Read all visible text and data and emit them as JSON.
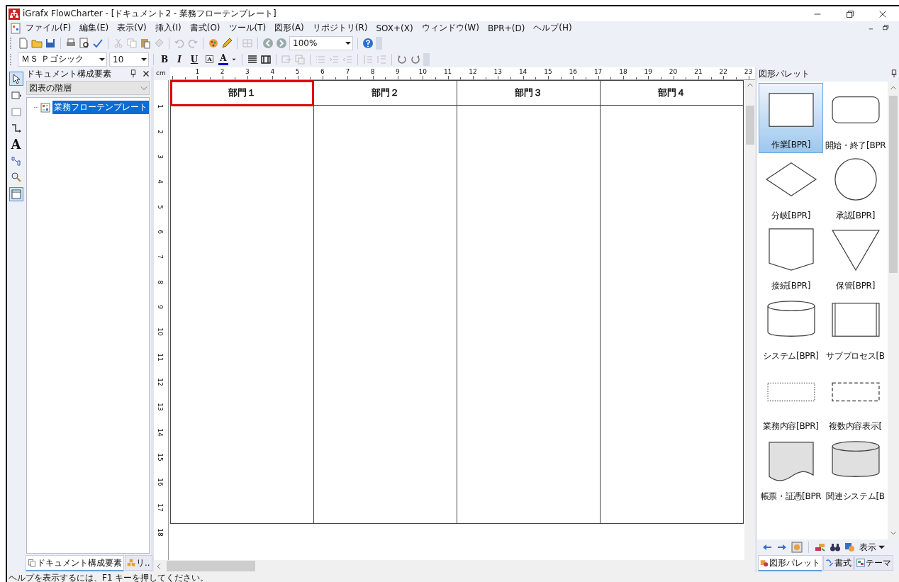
{
  "window": {
    "title": "iGrafx FlowCharter - [ドキュメント2 - 業務フローテンプレート]"
  },
  "menu": [
    "ファイル(F)",
    "編集(E)",
    "表示(V)",
    "挿入(I)",
    "書式(O)",
    "ツール(T)",
    "図形(A)",
    "リポジトリ(R)",
    "SOX+(X)",
    "ウィンドウ(W)",
    "BPR+(D)",
    "ヘルプ(H)"
  ],
  "toolbar": {
    "zoom": "100%"
  },
  "format_bar": {
    "font": "ＭＳ Ｐゴシック",
    "size": "10",
    "bold": "B",
    "italic": "I",
    "underline": "U",
    "small_a": "A",
    "font_color": "A"
  },
  "tool_strip": {
    "text_tool": "A"
  },
  "document_panel": {
    "title": "ドキュメント構成要素",
    "view": "図表の階層",
    "tree": [
      {
        "label": "業務フローテンプレート",
        "selected": true
      }
    ],
    "tabs": [
      {
        "label": "ドキュメント構成要素",
        "selected": true
      },
      {
        "label": "リ..",
        "selected": false
      }
    ]
  },
  "ruler": {
    "unit": "cm",
    "x_labels": [
      "1",
      "2",
      "3",
      "4",
      "5",
      "6",
      "7",
      "8",
      "9",
      "10",
      "11",
      "12",
      "13",
      "14",
      "15",
      "16",
      "17",
      "18",
      "19",
      "20",
      "21",
      "22",
      "23"
    ],
    "y_labels": [
      "1",
      "2",
      "3",
      "4",
      "5",
      "6",
      "7",
      "8",
      "9",
      "10",
      "11",
      "12",
      "13",
      "14",
      "15",
      "16",
      "17",
      "18"
    ]
  },
  "lanes": [
    {
      "label": "部門１",
      "highlighted": true
    },
    {
      "label": "部門２",
      "highlighted": false
    },
    {
      "label": "部門３",
      "highlighted": false
    },
    {
      "label": "部門４",
      "highlighted": false
    }
  ],
  "palette": {
    "title": "図形パレット",
    "shapes": [
      {
        "label": "作業[BPR]",
        "kind": "rect",
        "selected": true,
        "shaded": false
      },
      {
        "label": "開始・終了[BPR",
        "kind": "rounded",
        "selected": false,
        "shaded": false
      },
      {
        "label": "分岐[BPR]",
        "kind": "diamond",
        "selected": false,
        "shaded": false
      },
      {
        "label": "承認[BPR]",
        "kind": "circle",
        "selected": false,
        "shaded": false
      },
      {
        "label": "接続[BPR]",
        "kind": "offpage",
        "selected": false,
        "shaded": false
      },
      {
        "label": "保管[BPR]",
        "kind": "triangle",
        "selected": false,
        "shaded": false
      },
      {
        "label": "システム[BPR]",
        "kind": "cylinder",
        "selected": false,
        "shaded": false
      },
      {
        "label": "サブプロセス[B",
        "kind": "subprocess",
        "selected": false,
        "shaded": false
      },
      {
        "label": "業務内容[BPR]",
        "kind": "dotted",
        "selected": false,
        "shaded": false
      },
      {
        "label": "複数内容表示[",
        "kind": "dashed",
        "selected": false,
        "shaded": false
      },
      {
        "label": "帳票・証憑[BPR",
        "kind": "document",
        "selected": false,
        "shaded": true
      },
      {
        "label": "関連システム[B",
        "kind": "cylinder",
        "selected": false,
        "shaded": true
      }
    ],
    "view_menu": "表示",
    "tabs": [
      {
        "label": "図形パレット",
        "selected": true
      },
      {
        "label": "書式",
        "selected": false
      },
      {
        "label": "テーマ",
        "selected": false
      }
    ]
  },
  "status_bar": "ヘルプを表示するには、F1 キーを押してください。"
}
